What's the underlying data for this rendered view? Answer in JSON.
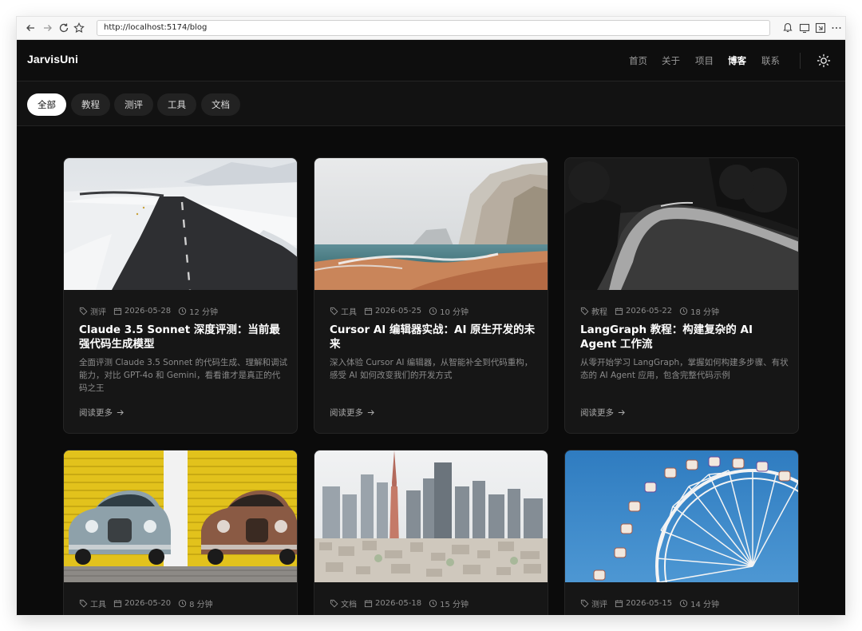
{
  "browser": {
    "url": "http://localhost:5174/blog"
  },
  "site": {
    "logo": "JarvisUni",
    "nav": [
      "首页",
      "关于",
      "项目",
      "博客",
      "联系"
    ],
    "active_nav": "博客"
  },
  "filters": [
    "全部",
    "教程",
    "测评",
    "工具",
    "文档"
  ],
  "active_filter": "全部",
  "read_more": "阅读更多",
  "posts": [
    {
      "category": "测评",
      "date": "2026-05-28",
      "read_time": "12 分钟",
      "title": "Claude 3.5 Sonnet 深度评测：当前最强代码生成模型",
      "desc": "全面评测 Claude 3.5 Sonnet 的代码生成、理解和调试能力，对比 GPT-4o 和 Gemini，看看谁才是真正的代码之王"
    },
    {
      "category": "工具",
      "date": "2026-05-25",
      "read_time": "10 分钟",
      "title": "Cursor AI 编辑器实战：AI 原生开发的未来",
      "desc": "深入体验 Cursor AI 编辑器，从智能补全到代码重构，感受 AI 如何改变我们的开发方式"
    },
    {
      "category": "教程",
      "date": "2026-05-22",
      "read_time": "18 分钟",
      "title": "LangGraph 教程：构建复杂的 AI Agent 工作流",
      "desc": "从零开始学习 LangGraph，掌握如何构建多步骤、有状态的 AI Agent 应用，包含完整代码示例"
    },
    {
      "category": "工具",
      "date": "2026-05-20",
      "read_time": "8 分钟"
    },
    {
      "category": "文档",
      "date": "2026-05-18",
      "read_time": "15 分钟"
    },
    {
      "category": "测评",
      "date": "2026-05-15",
      "read_time": "14 分钟"
    }
  ],
  "colors": {
    "page_bg": "#0b0b0b",
    "card_bg": "#161616",
    "accent": "#ffffff",
    "muted_text": "#8a8a8a"
  }
}
